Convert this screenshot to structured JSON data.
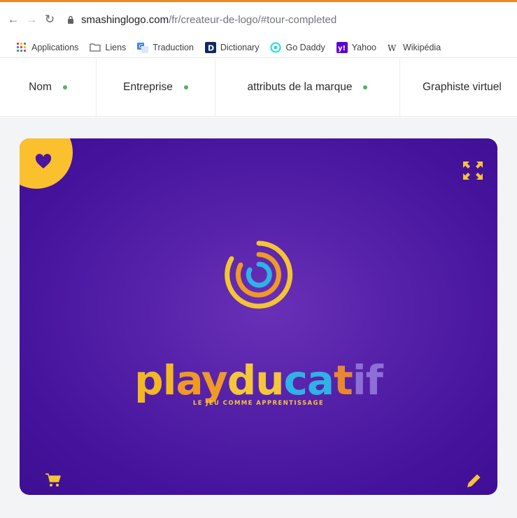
{
  "browser": {
    "url_domain": "smashinglogo.com",
    "url_path": "/fr/createur-de-logo/#tour-completed",
    "accent_color": "#e8892e"
  },
  "bookmarks": [
    {
      "label": "Applications",
      "icon": "apps-grid-icon"
    },
    {
      "label": "Liens",
      "icon": "folder-icon"
    },
    {
      "label": "Traduction",
      "icon": "translate-icon"
    },
    {
      "label": "Dictionary",
      "icon": "dictionary-icon"
    },
    {
      "label": "Go Daddy",
      "icon": "godaddy-icon"
    },
    {
      "label": "Yahoo",
      "icon": "yahoo-icon"
    },
    {
      "label": "Wikipédia",
      "icon": "wikipedia-icon"
    }
  ],
  "steps": [
    {
      "label": "Nom",
      "completed": true
    },
    {
      "label": "Entreprise",
      "completed": true
    },
    {
      "label": "attributs de la marque",
      "completed": true
    },
    {
      "label": "Graphiste virtuel",
      "completed": false
    }
  ],
  "logo_card": {
    "background": "#4a169f",
    "brand_word_parts": [
      {
        "text": "pl",
        "color": "#f2b824"
      },
      {
        "text": "ay",
        "color": "#f09a25"
      },
      {
        "text": "du",
        "color": "#f4c73a"
      },
      {
        "text": "ca",
        "color": "#2fb2e5"
      },
      {
        "text": "t",
        "color": "#e8892e"
      },
      {
        "text": "if",
        "color": "#8e6fd6"
      }
    ],
    "tagline": "LE JEU COMME APPRENTISSAGE",
    "icons": [
      "heart-icon",
      "expand-icon",
      "cart-icon",
      "pencil-icon"
    ]
  }
}
